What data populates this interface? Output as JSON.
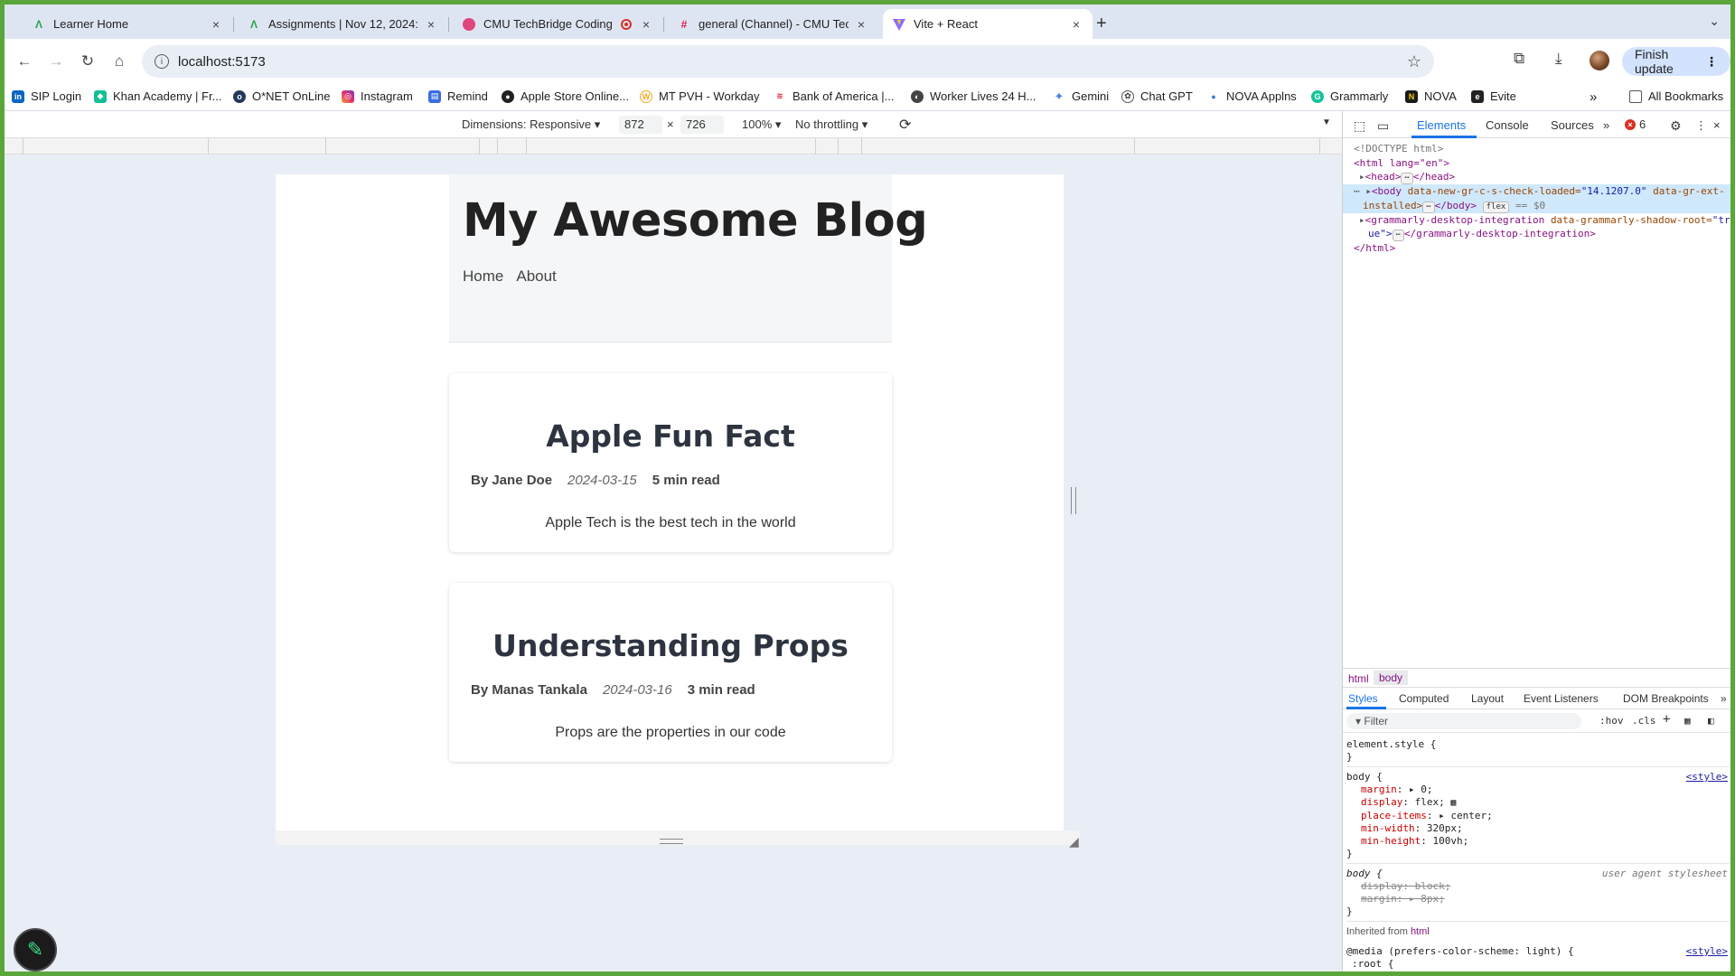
{
  "tabs": [
    {
      "title": "Learner Home",
      "icon": "learner-icon"
    },
    {
      "title": "Assignments | Nov 12, 2024:",
      "icon": "learner-icon"
    },
    {
      "title": "CMU TechBridge Coding",
      "icon": "pink-icon"
    },
    {
      "title": "general (Channel) - CMU Tec",
      "icon": "slack-icon"
    },
    {
      "title": "Vite + React",
      "icon": "vite-icon"
    }
  ],
  "address": {
    "url": "localhost:5173"
  },
  "finish_update": "Finish update",
  "bookmarks": [
    "SIP Login",
    "Khan Academy | Fr...",
    "O*NET OnLine",
    "Instagram",
    "Remind",
    "Apple Store Online...",
    "MT PVH - Workday",
    "Bank of America |...",
    "Worker Lives 24 H...",
    "Gemini",
    "Chat GPT",
    "NOVA Applns",
    "Grammarly",
    "NOVA",
    "Evite"
  ],
  "all_bookmarks": "All Bookmarks",
  "device_toolbar": {
    "dimensions": "Dimensions: Responsive",
    "width": "872",
    "times": "×",
    "height": "726",
    "zoom": "100%",
    "throttling": "No throttling"
  },
  "blog": {
    "title": "My Awesome Blog",
    "nav": [
      "Home",
      "About"
    ],
    "posts": [
      {
        "title": "Apple Fun Fact",
        "author": "By Jane Doe",
        "date": "2024-03-15",
        "read": "5 min read",
        "body": "Apple Tech is the best tech in the world"
      },
      {
        "title": "Understanding Props",
        "author": "By Manas Tankala",
        "date": "2024-03-16",
        "read": "3 min read",
        "body": "Props are the properties in our code"
      }
    ]
  },
  "devtools": {
    "tabs": [
      "Elements",
      "Console",
      "Sources"
    ],
    "error_count": "6",
    "dom": {
      "doctype": "<!DOCTYPE html>",
      "html_open": "<html lang=\"en\">",
      "head": "<head>",
      "head_close": "</head>",
      "body_open": "<body",
      "body_attr1": "data-new-gr-c-s-check-loaded=",
      "body_val1": "\"14.1207.0\"",
      "body_attr2": "data-gr-ext-",
      "body_line2": "installed>",
      "body_close": "</body>",
      "flex_pill": "flex",
      "dollar": "== $0",
      "grammarly_open": "<grammarly-desktop-integration",
      "grammarly_attr": "data-grammarly-shadow-root=",
      "grammarly_val": "\"tr",
      "grammarly_line2": "ue\">",
      "grammarly_close": "</grammarly-desktop-integration>",
      "html_close": "</html>",
      "ellipsis": "⋯"
    },
    "breadcrumbs": [
      "html",
      "body"
    ],
    "styles_tabs": [
      "Styles",
      "Computed",
      "Layout",
      "Event Listeners",
      "DOM Breakpoints"
    ],
    "filter_placeholder": "Filter",
    "hov": ":hov",
    "cls": ".cls",
    "rules": {
      "element_style": "element.style {",
      "close": "}",
      "body_sel": "body {",
      "source": "<style>",
      "margin": "margin",
      "margin_val": "▸ 0;",
      "display": "display",
      "display_val": "flex;",
      "place_items": "place-items",
      "place_items_val": "▸ center;",
      "min_width": "min-width",
      "min_width_val": "320px;",
      "min_height": "min-height",
      "min_height_val": "100vh;",
      "ua_label": "user agent stylesheet",
      "ua_display": "display: block;",
      "ua_margin": "margin: ▸ 8px;",
      "inherited": "Inherited from",
      "inherited_el": "html",
      "media": "@media (prefers-color-scheme: light) {",
      "root": ":root {"
    }
  }
}
